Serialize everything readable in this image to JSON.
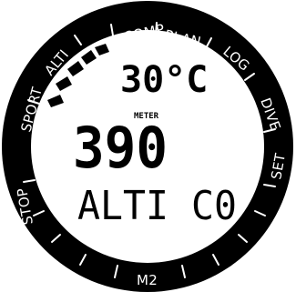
{
  "bezel": {
    "labels": [
      "COMP",
      "PLAN",
      "LOG",
      "DIVE",
      "SET",
      "M2",
      "STOP",
      "SPORT",
      "ALTI"
    ]
  },
  "display": {
    "temperature": "30°C",
    "depth_unit": "METER",
    "altitude": "390",
    "mode_text": "ALTI C0"
  },
  "colors": {
    "bezel": "#000000",
    "screen": "#ffffff",
    "segments": "#000000"
  }
}
